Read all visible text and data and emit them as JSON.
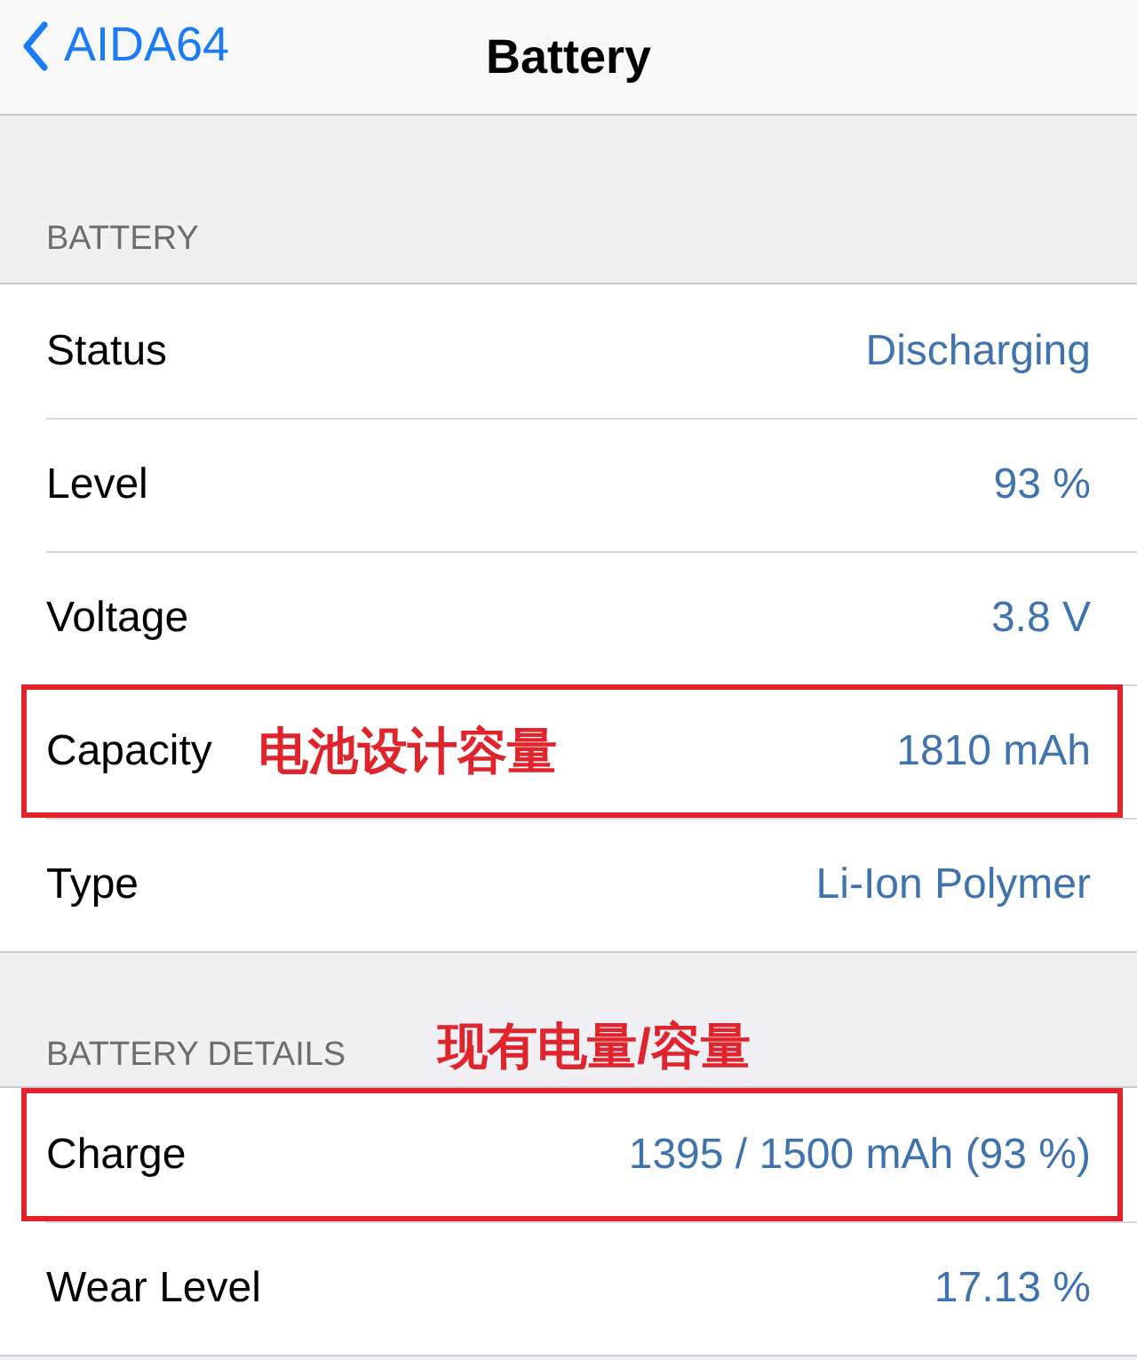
{
  "nav_bar": {
    "back_label": "AIDA64",
    "title": "Battery"
  },
  "sections": [
    {
      "title": "BATTERY",
      "rows": [
        {
          "label": "Status",
          "value": "Discharging"
        },
        {
          "label": "Level",
          "value": "93 %"
        },
        {
          "label": "Voltage",
          "value": "3.8 V"
        },
        {
          "label": "Capacity",
          "value": "1810 mAh",
          "highlighted": true,
          "note": "电池设计容量"
        },
        {
          "label": "Type",
          "value": "Li-Ion Polymer"
        }
      ]
    },
    {
      "title": "BATTERY DETAILS",
      "note": "现有电量/容量",
      "rows": [
        {
          "label": "Charge",
          "value": "1395 / 1500 mAh (93 %)",
          "highlighted": true
        },
        {
          "label": "Wear Level",
          "value": "17.13 %"
        }
      ]
    }
  ]
}
